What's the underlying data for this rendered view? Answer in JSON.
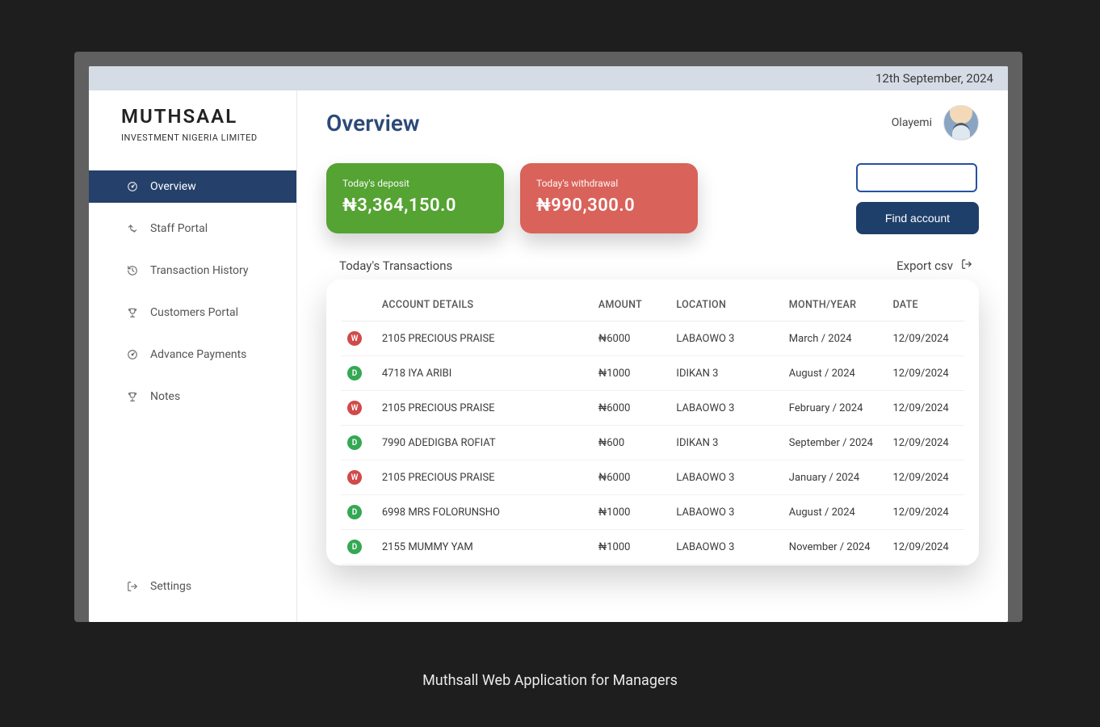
{
  "date_bar": "12th September, 2024",
  "brand": {
    "name": "MUTHSAAL",
    "sub": "INVESTMENT NIGERIA LIMITED"
  },
  "page_title": "Overview",
  "user": {
    "name": "Olayemi"
  },
  "sidebar": {
    "items": [
      {
        "label": "Overview",
        "icon": "dashboard-icon",
        "active": true
      },
      {
        "label": "Staff Portal",
        "icon": "recycle-icon",
        "active": false
      },
      {
        "label": "Transaction History",
        "icon": "history-icon",
        "active": false
      },
      {
        "label": "Customers Portal",
        "icon": "trophy-icon",
        "active": false
      },
      {
        "label": "Advance Payments",
        "icon": "dashboard-icon",
        "active": false
      },
      {
        "label": "Notes",
        "icon": "trophy-icon",
        "active": false
      }
    ],
    "footer": {
      "label": "Settings",
      "icon": "logout-icon"
    }
  },
  "cards": {
    "deposit": {
      "label": "Today's deposit",
      "value": "₦3,364,150.0"
    },
    "withdrawal": {
      "label": "Today's withdrawal",
      "value": "₦990,300.0"
    }
  },
  "search": {
    "value": "",
    "button": "Find account"
  },
  "table": {
    "title": "Today's Transactions",
    "export_label": "Export csv",
    "columns": [
      "",
      "ACCOUNT DETAILS",
      "AMOUNT",
      "LOCATION",
      "MONTH/YEAR",
      "DATE"
    ],
    "rows": [
      {
        "type": "W",
        "account": "2105 PRECIOUS PRAISE",
        "amount": "₦6000",
        "location": "LABAOWO 3",
        "month": "March / 2024",
        "date": "12/09/2024"
      },
      {
        "type": "D",
        "account": "4718 IYA ARIBI",
        "amount": "₦1000",
        "location": "IDIKAN 3",
        "month": "August / 2024",
        "date": "12/09/2024"
      },
      {
        "type": "W",
        "account": "2105 PRECIOUS PRAISE",
        "amount": "₦6000",
        "location": "LABAOWO 3",
        "month": "February / 2024",
        "date": "12/09/2024"
      },
      {
        "type": "D",
        "account": "7990 ADEDIGBA ROFIAT",
        "amount": "₦600",
        "location": "IDIKAN 3",
        "month": "September / 2024",
        "date": "12/09/2024"
      },
      {
        "type": "W",
        "account": "2105 PRECIOUS PRAISE",
        "amount": "₦6000",
        "location": "LABAOWO 3",
        "month": "January / 2024",
        "date": "12/09/2024"
      },
      {
        "type": "D",
        "account": "6998 MRS FOLORUNSHO",
        "amount": "₦1000",
        "location": "LABAOWO 3",
        "month": "August / 2024",
        "date": "12/09/2024"
      },
      {
        "type": "D",
        "account": "2155 MUMMY YAM",
        "amount": "₦1000",
        "location": "LABAOWO 3",
        "month": "November / 2024",
        "date": "12/09/2024"
      }
    ]
  },
  "caption": "Muthsall Web Application for Managers"
}
